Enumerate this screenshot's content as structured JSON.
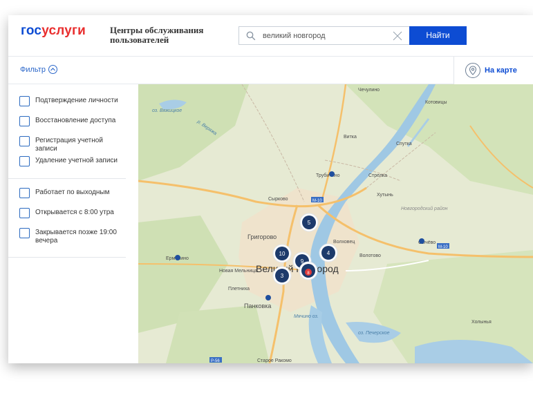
{
  "header": {
    "logo_part1": "гос",
    "logo_part2": "услуги",
    "title": "Центры обслуживания пользователей",
    "search_value": "великий новгород",
    "find_button": "Найти"
  },
  "filter": {
    "label": "Фильтр",
    "map_tab": "На карте"
  },
  "services": [
    "Подтверждение личности",
    "Восстановление доступа",
    "Регистрация учетной записи",
    "Удаление учетной записи"
  ],
  "schedule": [
    "Работает по выходным",
    "Открывается с 8:00 утра",
    "Закрывается позже 19:00 вечера"
  ],
  "map": {
    "city": "Великий Новгород",
    "places": {
      "chechulino": "Чечулино",
      "kotovitsy": "Котовицы",
      "vishera": "оз. Вяжицкое",
      "veryazha": "р. Веряжа",
      "vitka": "Витка",
      "spupka": "Спутка",
      "trubichino": "Трубичино",
      "strelka": "Стрелка",
      "khutyn": "Хутынь",
      "syrkovo": "Сырково",
      "novgorod_raion": "Новгородский район",
      "grigorovo": "Григорово",
      "volkhovets": "Волховец",
      "sychevo": "Сычёво",
      "volotovo": "Волотово",
      "ermolino": "Ермолино",
      "nov_melnitsa": "Новая Мельница",
      "pletnikha": "Плетниха",
      "pankovka": "Панковка",
      "myachino": "Мячино оз.",
      "pecherskoe": "оз. Печерское",
      "kholynya": "Холынья",
      "staroe_rakomo": "Старое Ракомо",
      "road_m10": "М-10",
      "road_r56": "Р-56"
    },
    "clusters": [
      "5",
      "10",
      "4",
      "9",
      "3",
      "8"
    ]
  }
}
